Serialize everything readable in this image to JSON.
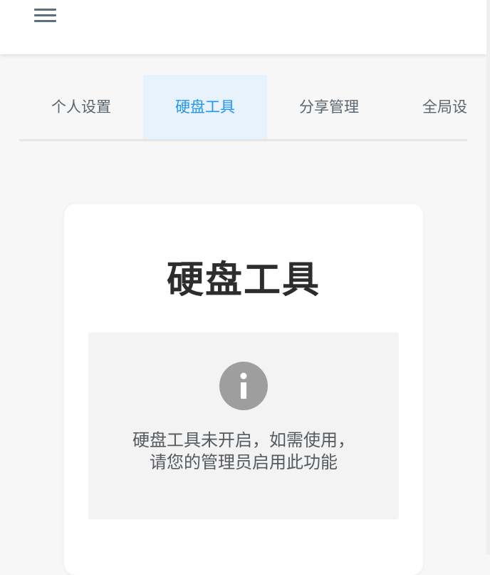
{
  "header": {
    "menu_icon": "hamburger-menu-icon"
  },
  "tabs": [
    {
      "label": "个人设置",
      "active": false
    },
    {
      "label": "硬盘工具",
      "active": true
    },
    {
      "label": "分享管理",
      "active": false
    },
    {
      "label": "全局设",
      "active": false
    }
  ],
  "card": {
    "title": "硬盘工具",
    "notice": {
      "icon": "info-icon",
      "line1": "硬盘工具未开启，如需使用，",
      "line2": "请您的管理员启用此功能"
    }
  },
  "colors": {
    "accent": "#2196f3",
    "active_tab_bg": "#e8f2fd",
    "info_icon": "#9e9e9e"
  }
}
